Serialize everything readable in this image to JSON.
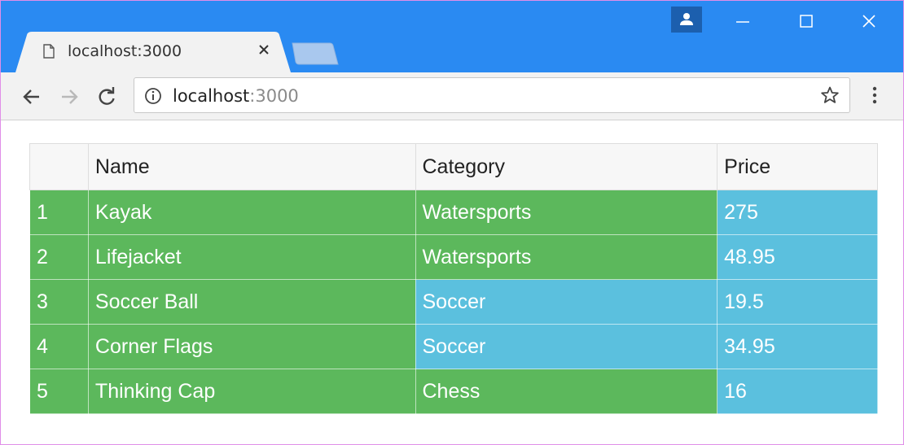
{
  "browser": {
    "tab": {
      "title": "localhost:3000",
      "icon": "page-icon"
    },
    "address": {
      "host": "localhost",
      "port": ":3000",
      "icon": "info-icon"
    },
    "colors": {
      "titlebar": "#2a8af2",
      "toolbar": "#f2f2f2"
    }
  },
  "table": {
    "headers": [
      "",
      "Name",
      "Category",
      "Price"
    ],
    "rows": [
      {
        "num": "1",
        "name": "Kayak",
        "category": "Watersports",
        "price": "275"
      },
      {
        "num": "2",
        "name": "Lifejacket",
        "category": "Watersports",
        "price": "48.95"
      },
      {
        "num": "3",
        "name": "Soccer Ball",
        "category": "Soccer",
        "price": "19.5"
      },
      {
        "num": "4",
        "name": "Corner Flags",
        "category": "Soccer",
        "price": "34.95"
      },
      {
        "num": "5",
        "name": "Thinking Cap",
        "category": "Chess",
        "price": "16"
      }
    ],
    "colors": {
      "success": "#5cb85c",
      "info": "#5bc0de"
    }
  }
}
